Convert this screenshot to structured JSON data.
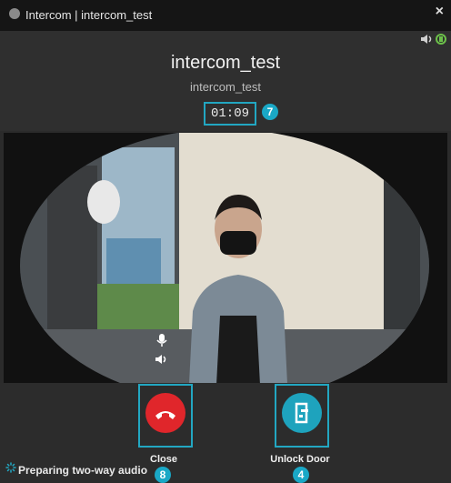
{
  "window": {
    "title": "Intercom | intercom_test",
    "close_glyph": "×"
  },
  "header": {
    "name": "intercom_test",
    "subname": "intercom_test",
    "timer": "01:09"
  },
  "badges": {
    "timer": "7",
    "close": "8",
    "unlock": "4"
  },
  "controls": {
    "close_label": "Close",
    "unlock_label": "Unlock Door"
  },
  "status": {
    "text": "Preparing two-way audio"
  },
  "colors": {
    "accent": "#22a7c2",
    "hangup": "#e0262b",
    "unlock": "#1ea3bd"
  }
}
